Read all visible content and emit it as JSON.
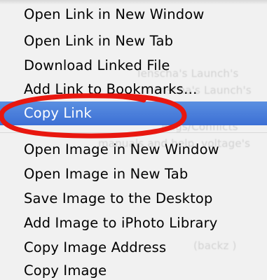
{
  "background_text": [
    "Ienscha's Launch's",
    "Ilenscha's Launch's",
    "Bugs/Conflicts",
    "manuals and help, voltage's",
    "(backz )"
  ],
  "menu": {
    "link_items": [
      "Open Link in New Window",
      "Open Link in New Tab",
      "Download Linked File",
      "Add Link to Bookmarks…",
      "Copy Link"
    ],
    "image_items": [
      "Open Image in New Window",
      "Open Image in New Tab",
      "Save Image to the Desktop",
      "Add Image to iPhoto Library",
      "Copy Image Address",
      "Copy Image"
    ],
    "selected_item": "Copy Link"
  },
  "colors": {
    "highlight": "#3c6fd4",
    "annotation": "#e8170f",
    "menu_background": "#f1f1f1"
  },
  "annotation": {
    "shape": "ellipse",
    "target": "Copy Link"
  }
}
